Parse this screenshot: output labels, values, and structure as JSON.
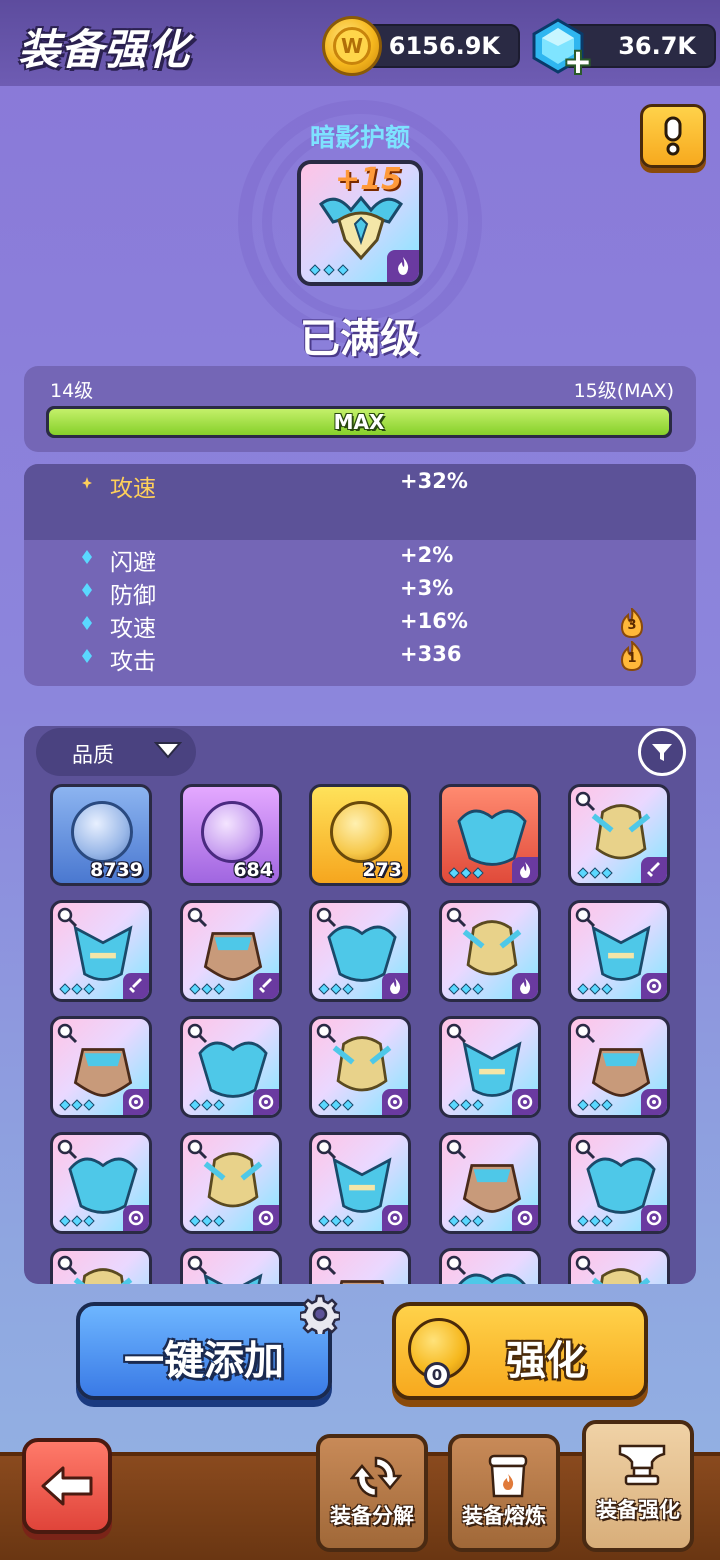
{
  "header": {
    "title": "装备强化",
    "coins": "6156.9K",
    "gems": "36.7K",
    "coin_icon": "coin-icon",
    "gem_icon": "gem-icon",
    "add_icon": "plus-icon"
  },
  "featured": {
    "name": "暗影护额",
    "level_badge": "+15",
    "status": "已满级",
    "help_icon": "exclamation-icon"
  },
  "level": {
    "current": "14级",
    "next": "15级(MAX)",
    "bar_label": "MAX",
    "progress": 1.0
  },
  "stats": {
    "primary": [
      {
        "name": "攻速",
        "value": "+32%"
      }
    ],
    "secondary": [
      {
        "name": "闪避",
        "value": "+2%",
        "badge": ""
      },
      {
        "name": "防御",
        "value": "+3%",
        "badge": ""
      },
      {
        "name": "攻速",
        "value": "+16%",
        "badge": "3"
      },
      {
        "name": "攻击",
        "value": "+336",
        "badge": "1"
      }
    ]
  },
  "inventory": {
    "quality_label": "品质",
    "materials": [
      {
        "kind": "silver",
        "count": "8739"
      },
      {
        "kind": "purple",
        "count": "684"
      },
      {
        "kind": "gold",
        "count": "273"
      }
    ]
  },
  "actions": {
    "add_all": "一键添加",
    "enhance": "强化",
    "enhance_cost": "0"
  },
  "nav": {
    "tabs": [
      {
        "label": "装备分解"
      },
      {
        "label": "装备熔炼"
      },
      {
        "label": "装备强化"
      }
    ]
  },
  "colors": {
    "accent_gold": "#f7a91e",
    "accent_blue": "#3a7ae6",
    "progress_green": "#86d02a",
    "item_name": "#7ee2ff",
    "primary_stat": "#ffd05a"
  }
}
